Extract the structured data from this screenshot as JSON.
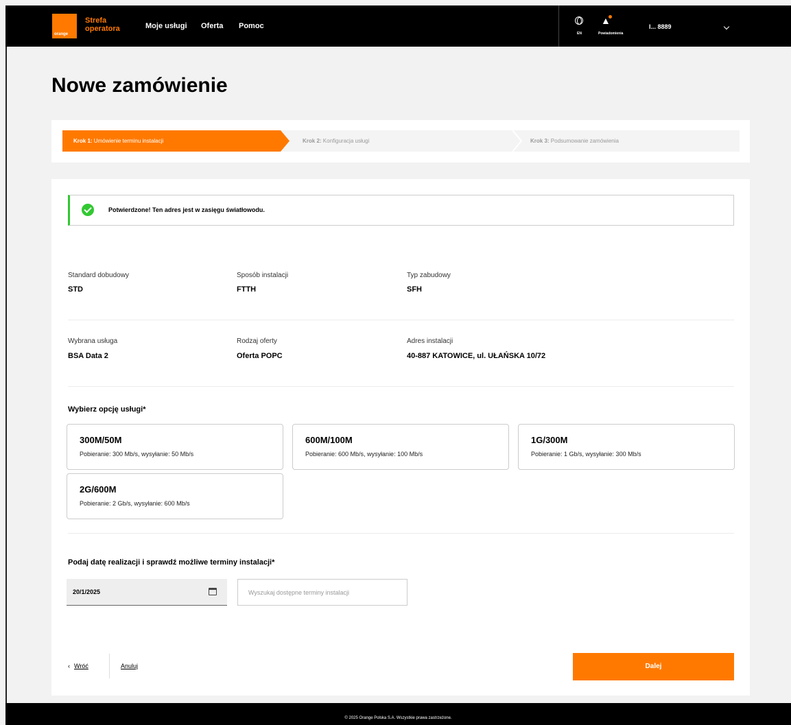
{
  "header": {
    "logo_text": "orange",
    "brand_line1": "Strefa",
    "brand_line2": "operatora",
    "nav": [
      "Moje usługi",
      "Oferta",
      "Pomoc"
    ],
    "language": "EN",
    "notifications_label": "Powiadomienia",
    "user_label": "I... 8889"
  },
  "page": {
    "title": "Nowe zamówienie"
  },
  "steps": [
    {
      "prefix": "Krok 1:",
      "label": "Umówienie terminu instalacji",
      "active": true
    },
    {
      "prefix": "Krok 2:",
      "label": "Konfiguracja usługi",
      "active": false
    },
    {
      "prefix": "Krok 3:",
      "label": "Podsumowanie zamówienia",
      "active": false
    }
  ],
  "alert": {
    "text": "Potwierdzone! Ten adres jest w zasięgu światłowodu."
  },
  "details": {
    "row1": [
      {
        "label": "Standard dobudowy",
        "value": "STD"
      },
      {
        "label": "Sposób instalacji",
        "value": "FTTH"
      },
      {
        "label": "Typ zabudowy",
        "value": "SFH"
      }
    ],
    "row2": [
      {
        "label": "Wybrana usługa",
        "value": "BSA Data 2"
      },
      {
        "label": "Rodzaj oferty",
        "value": "Oferta POPC"
      },
      {
        "label": "Adres instalacji",
        "value": "40-887 KATOWICE, ul. UŁAŃSKA 10/72"
      }
    ]
  },
  "service_options": {
    "heading": "Wybierz opcję usługi*",
    "items": [
      {
        "title": "300M/50M",
        "desc": "Pobieranie: 300 Mb/s, wysyłanie: 50 Mb/s"
      },
      {
        "title": "600M/100M",
        "desc": "Pobieranie: 600 Mb/s, wysyłanie: 100 Mb/s"
      },
      {
        "title": "1G/300M",
        "desc": "Pobieranie: 1 Gb/s, wysyłanie: 300 Mb/s"
      },
      {
        "title": "2G/600M",
        "desc": "Pobieranie: 2 Gb/s, wysyłanie: 600 Mb/s"
      }
    ]
  },
  "date_section": {
    "heading": "Podaj datę realizacji i sprawdź możliwe terminy instalacji*",
    "date_value": "20/1/2025",
    "search_button": "Wyszukaj dostępne terminy instalacji"
  },
  "actions": {
    "back": "Wróć",
    "back_arrow": "‹",
    "cancel": "Anuluj",
    "next": "Dalej"
  },
  "footer": {
    "text": "© 2025 Orange Polska S.A. Wszystkie prawa zastrzeżone."
  },
  "colors": {
    "accent": "#ff7900",
    "success": "#32c832"
  }
}
